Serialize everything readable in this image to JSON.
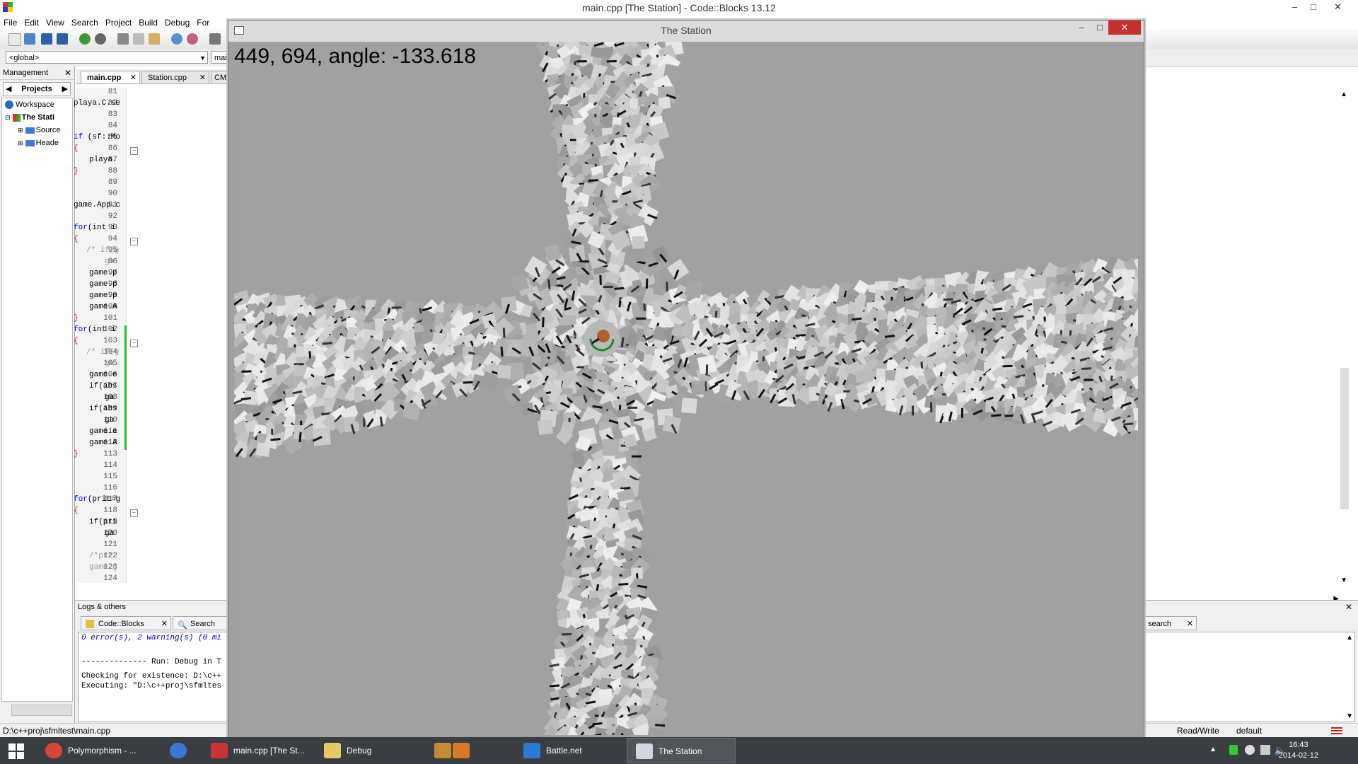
{
  "main_window": {
    "title": "main.cpp [The Station] - Code::Blocks 13.12",
    "controls": {
      "minimize": "–",
      "maximize": "□",
      "close": "✕"
    }
  },
  "menu": [
    "File",
    "Edit",
    "View",
    "Search",
    "Project",
    "Build",
    "Debug",
    "For"
  ],
  "toolbar2": {
    "scope": "<global>",
    "symbol": "mair"
  },
  "management": {
    "title": "Management",
    "tab": "Projects",
    "tree": [
      "Workspace",
      "The Stati",
      "Source",
      "Heade"
    ]
  },
  "editor": {
    "tabs": [
      {
        "label": "main.cpp",
        "active": true
      },
      {
        "label": "Station.cpp",
        "active": false
      },
      {
        "label": "CM",
        "active": false
      }
    ],
    "close_glyph": "✕",
    "line_numbers": [
      "81",
      "82",
      "83",
      "84",
      "85",
      "86",
      "87",
      "88",
      "89",
      "90",
      "91",
      "92",
      "93",
      "94",
      "95",
      "96",
      "97",
      "98",
      "99",
      "100",
      "101",
      "102",
      "103",
      "104",
      "105",
      "106",
      "107",
      "108",
      "109",
      "110",
      "111",
      "112",
      "113",
      "114",
      "115",
      "116",
      "117",
      "118",
      "119",
      "120",
      "121",
      "122",
      "123",
      "124"
    ],
    "code": {
      "82": "playa.C.se",
      "85_kw": "if",
      "85": " (sf::Mo",
      "86": "{",
      "87": "playa.",
      "88": "}",
      "91": "game.App.c",
      "93_kw": "for",
      "93": "(int i",
      "94": "{",
      "95": "/* if(g",
      "96": "ga",
      "97": "game.p",
      "98": "game.p",
      "99": "game.p",
      "100": "game.A",
      "101": "}",
      "102_kw": "for",
      "102": "(int i",
      "103": "{",
      "104": "/* if(g",
      "105": "ga",
      "106": "game.e",
      "107": "if(abs",
      "108": "ga",
      "109": "if(abs",
      "110": "ga",
      "111": "game.e",
      "112": "game.A",
      "113": "}",
      "117_kw": "for",
      "117": "(prit=g",
      "118": "{",
      "119": "if(pri",
      "120": "ga",
      "122": "/*pri",
      "123": "game.g"
    }
  },
  "logs": {
    "title": "Logs & others",
    "tabs": [
      "Code::Blocks",
      "Search resu"
    ],
    "right_tab": "search",
    "lines": [
      "0 error(s), 2 warning(s) (0 mi",
      "-------------- Run: Debug in T",
      "Checking for existence: D:\\c++",
      "Executing: \"D:\\c++proj\\sfmltes"
    ]
  },
  "statusbar": {
    "path": "D:\\c++proj\\sfmltest\\main.cpp",
    "mode": "Read/Write",
    "profile": "default"
  },
  "game_window": {
    "title": "The Station",
    "overlay_text": "449, 694, angle: -133.618",
    "controls": {
      "minimize": "–",
      "maximize": "□",
      "close": "✕"
    }
  },
  "taskbar": {
    "items": [
      {
        "label": "Polymorphism - ...",
        "icon": "chrome-icon",
        "open": false
      },
      {
        "label": "",
        "icon": "chrome-icon-2",
        "open": false
      },
      {
        "label": "main.cpp [The St...",
        "icon": "codeblocks-icon",
        "open": false
      },
      {
        "label": "Debug",
        "icon": "folder-icon",
        "open": false
      },
      {
        "label": "",
        "icon": "hearthstone-icon",
        "open": false
      },
      {
        "label": "",
        "icon": "fox-icon",
        "open": false
      },
      {
        "label": "Battle.net",
        "icon": "battlenet-icon",
        "open": false
      },
      {
        "label": "The Station",
        "icon": "window-icon",
        "open": true
      }
    ],
    "time": "16:43",
    "date": "2014-02-12"
  }
}
